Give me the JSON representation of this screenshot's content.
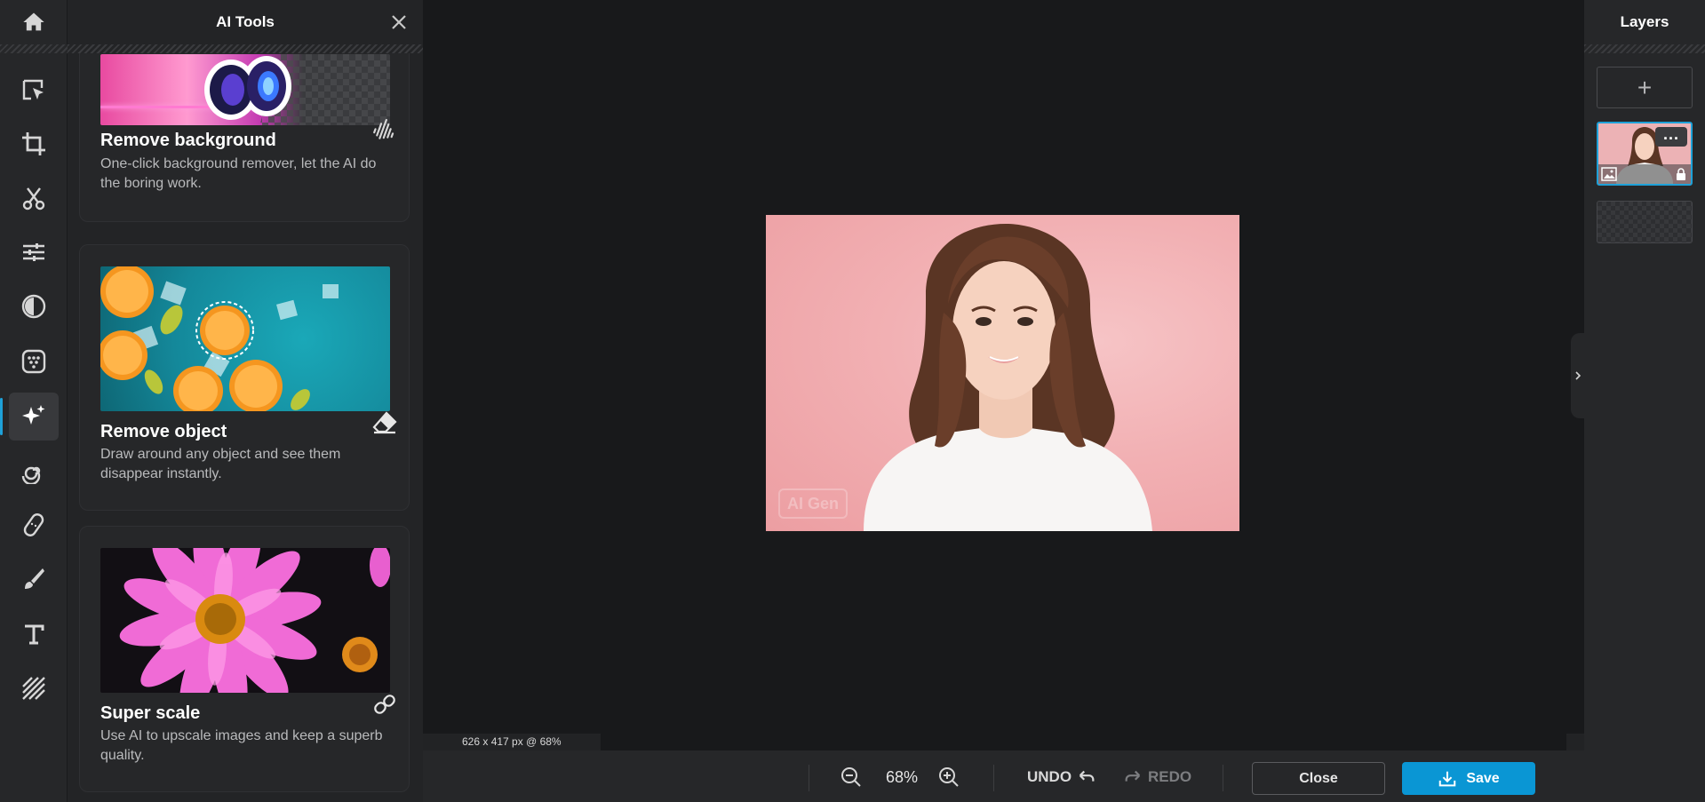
{
  "panel": {
    "title": "AI Tools",
    "cards": [
      {
        "title": "Remove background",
        "desc": "One-click background remover, let the AI do the boring work."
      },
      {
        "title": "Remove object",
        "desc": "Draw around any object and see them disappear instantly."
      },
      {
        "title": "Super scale",
        "desc": "Use AI to upscale images and keep a superb quality."
      }
    ]
  },
  "canvas": {
    "info": "626 x 417 px @ 68%",
    "watermark": "AI Gen"
  },
  "layers": {
    "title": "Layers",
    "add_label": "+",
    "more_label": "..."
  },
  "bottombar": {
    "zoom": "68%",
    "undo_label": "UNDO",
    "redo_label": "REDO",
    "close_label": "Close",
    "save_label": "Save"
  },
  "colors": {
    "accent": "#1ea1d8",
    "save": "#0a96d4"
  }
}
